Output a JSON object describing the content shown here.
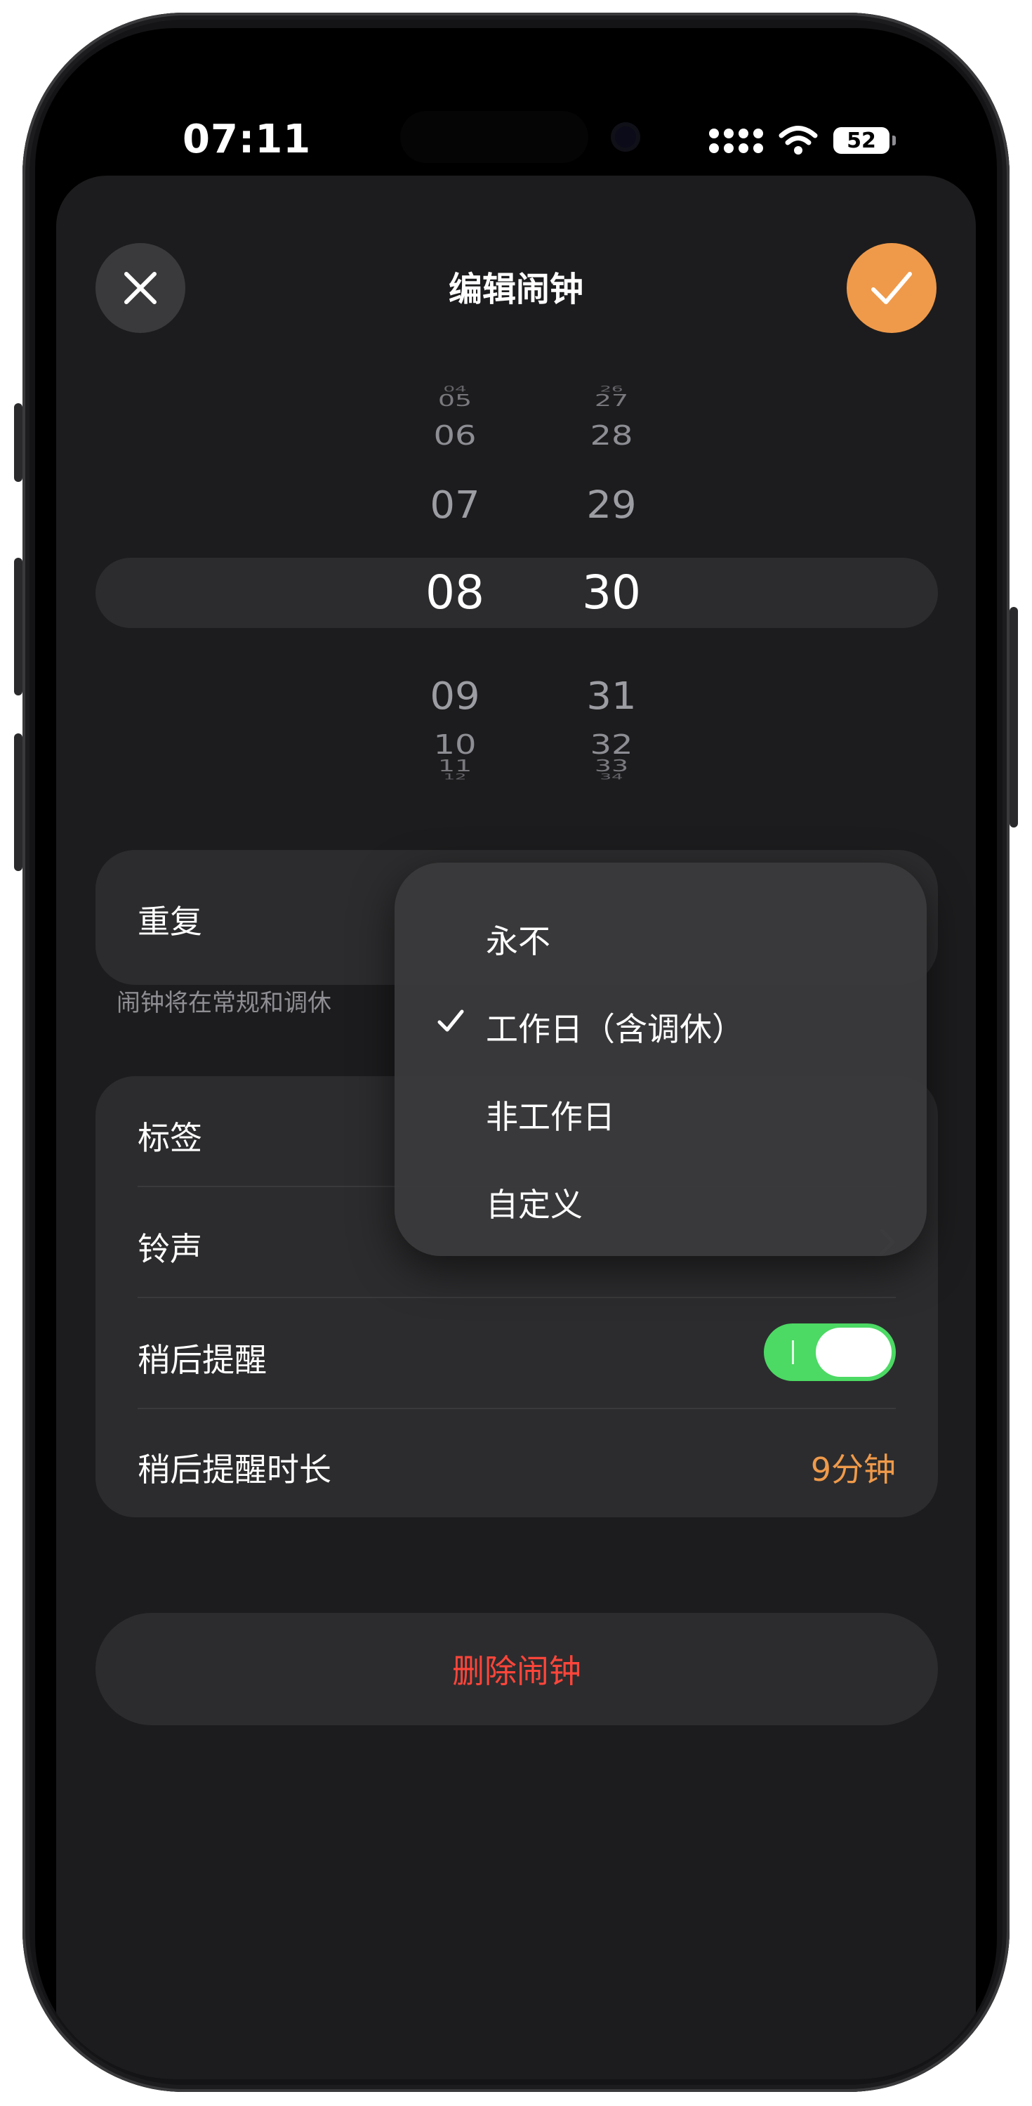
{
  "status": {
    "time": "07:11",
    "battery": "52"
  },
  "header": {
    "title": "编辑闹钟"
  },
  "picker": {
    "hours": [
      "04",
      "05",
      "06",
      "07",
      "08",
      "09",
      "10",
      "11",
      "12"
    ],
    "minutes": [
      "26",
      "27",
      "28",
      "29",
      "30",
      "31",
      "32",
      "33",
      "34"
    ],
    "selected_hour": "08",
    "selected_minute": "30"
  },
  "repeat": {
    "label": "重复",
    "footnote": "闹钟将在常规和调休"
  },
  "settings": {
    "tag_label": "标签",
    "ringtone_label": "铃声",
    "snooze_label": "稍后提醒",
    "snooze_enabled": true,
    "snooze_duration_label": "稍后提醒时长",
    "snooze_duration_value": "9分钟"
  },
  "delete_label": "删除闹钟",
  "repeat_menu": {
    "options": [
      {
        "label": "永不",
        "checked": false
      },
      {
        "label": "工作日（含调休）",
        "checked": true
      },
      {
        "label": "非工作日",
        "checked": false
      },
      {
        "label": "自定义",
        "checked": false
      }
    ]
  },
  "colors": {
    "accent": "#ef9a4a",
    "toggle_on": "#4cd964",
    "destructive": "#ff453a",
    "background": "#1c1c1e",
    "cell": "#2c2c2e"
  }
}
